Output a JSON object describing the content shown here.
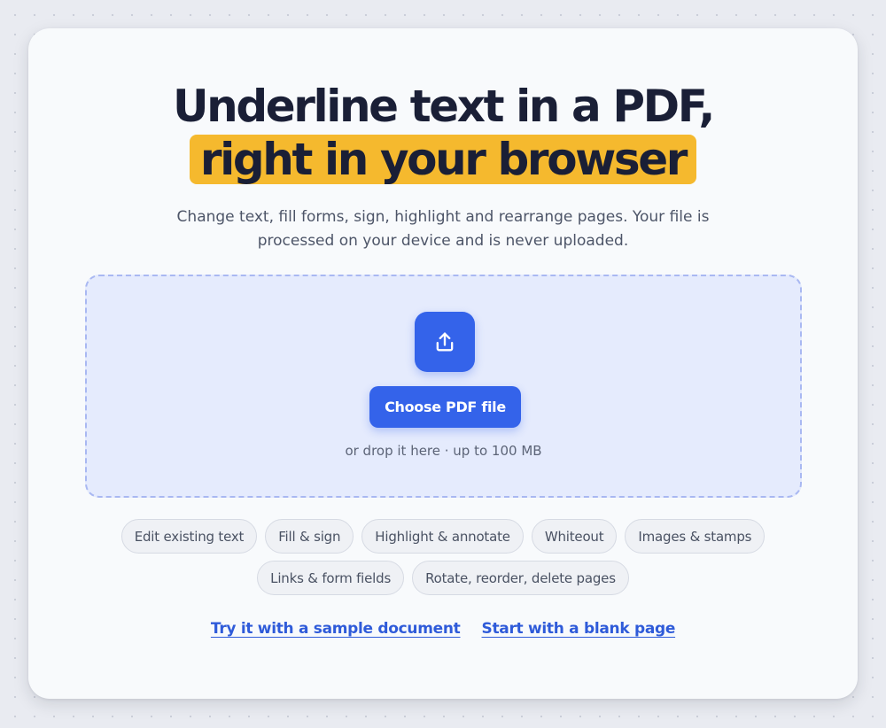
{
  "headline": {
    "line1": "Underline text in a PDF,",
    "line2": "right in your browser"
  },
  "subtitle": "Change text, fill forms, sign, highlight and rearrange pages. Your file is processed on your device and is never uploaded.",
  "dropzone": {
    "upload_icon": "upload-icon",
    "button_label": "Choose PDF file",
    "hint": "or drop it here · up to 100 MB"
  },
  "features": {
    "row1": [
      "Edit existing text",
      "Fill & sign",
      "Highlight & annotate",
      "Whiteout",
      "Images & stamps"
    ],
    "row2": [
      "Links & form fields",
      "Rotate, reorder, delete pages"
    ]
  },
  "links": {
    "sample": "Try it with a sample document",
    "blank": "Start with a blank page"
  },
  "colors": {
    "accent": "#3463ea",
    "highlight": "#f5b92e",
    "heading": "#1a1f36",
    "link": "#2f5bd9"
  }
}
